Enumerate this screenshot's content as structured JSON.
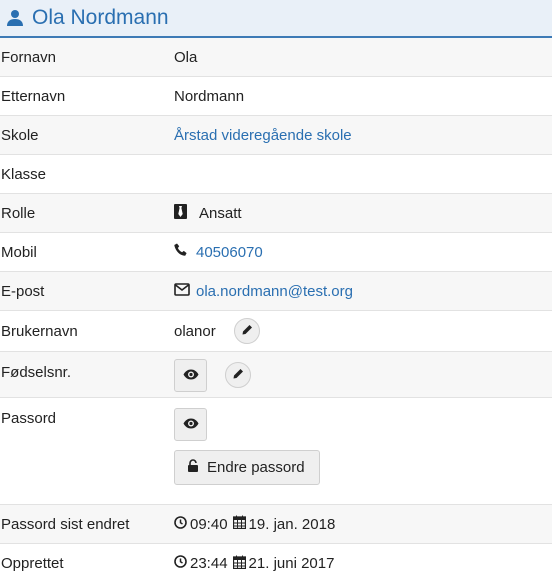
{
  "header": {
    "title": "Ola Nordmann",
    "icon": "user-icon"
  },
  "fields": {
    "fornavn": {
      "label": "Fornavn",
      "value": "Ola"
    },
    "etternavn": {
      "label": "Etternavn",
      "value": "Nordmann"
    },
    "skole": {
      "label": "Skole",
      "value": "Årstad videregående skole"
    },
    "klasse": {
      "label": "Klasse",
      "value": ""
    },
    "rolle": {
      "label": "Rolle",
      "value": "Ansatt",
      "icon": "necktie-icon"
    },
    "mobil": {
      "label": "Mobil",
      "value": "40506070",
      "icon": "phone-icon"
    },
    "epost": {
      "label": "E-post",
      "value": "ola.nordmann@test.org",
      "icon": "envelope-icon"
    },
    "brukernavn": {
      "label": "Brukernavn",
      "value": "olanor"
    },
    "fodselsnr": {
      "label": "Fødselsnr."
    },
    "passord": {
      "label": "Passord",
      "change_button": "Endre passord"
    },
    "passord_endret": {
      "label": "Passord sist endret",
      "time": "09:40",
      "date": "19. jan. 2018"
    },
    "opprettet": {
      "label": "Opprettet",
      "time": "23:44",
      "date": "21. juni 2017"
    }
  },
  "colors": {
    "link": "#2a6fb1",
    "header_bg": "#e9f0f8",
    "header_border": "#3d7ab6"
  }
}
